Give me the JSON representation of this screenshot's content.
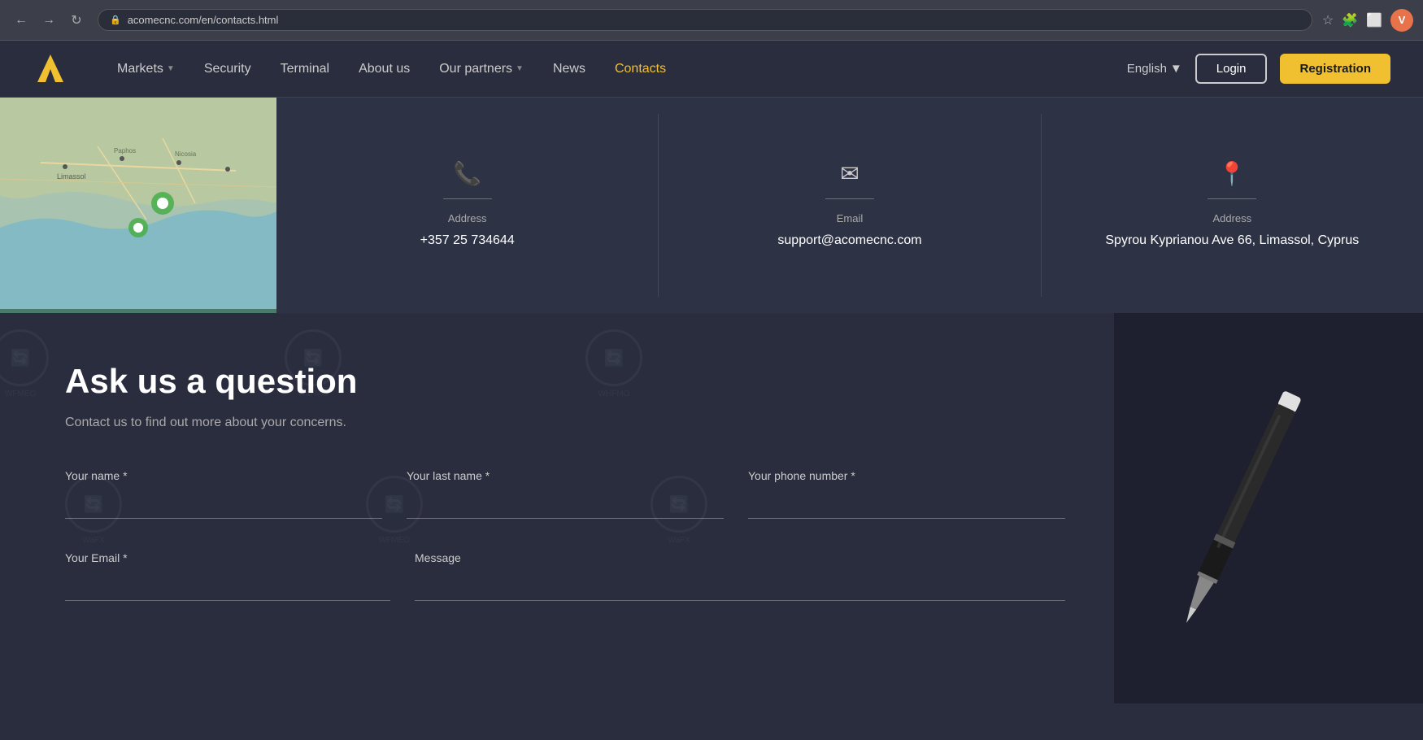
{
  "browser": {
    "url": "acomecnc.com/en/contacts.html",
    "user_initial": "V"
  },
  "navbar": {
    "logo_letter": "A",
    "links": [
      {
        "id": "markets",
        "label": "Markets",
        "has_dropdown": true,
        "active": false
      },
      {
        "id": "security",
        "label": "Security",
        "has_dropdown": false,
        "active": false
      },
      {
        "id": "terminal",
        "label": "Terminal",
        "has_dropdown": false,
        "active": false
      },
      {
        "id": "about-us",
        "label": "About us",
        "has_dropdown": false,
        "active": false
      },
      {
        "id": "our-partners",
        "label": "Our partners",
        "has_dropdown": true,
        "active": false
      },
      {
        "id": "news",
        "label": "News",
        "has_dropdown": false,
        "active": false
      },
      {
        "id": "contacts",
        "label": "Contacts",
        "has_dropdown": false,
        "active": true
      }
    ],
    "language": "English",
    "login_label": "Login",
    "register_label": "Registration"
  },
  "contact_panels": [
    {
      "id": "phone",
      "icon": "📞",
      "label": "Address",
      "value": "+357 25 734644"
    },
    {
      "id": "email",
      "icon": "✉",
      "label": "Email",
      "value": "support@acomecnc.com"
    },
    {
      "id": "location",
      "icon": "📍",
      "label": "Address",
      "value": "Spyrou Kyprianou Ave 66, Limassol, Cyprus"
    }
  ],
  "ask_form": {
    "title": "Ask us a question",
    "subtitle": "Contact us to find out more about your concerns.",
    "fields": [
      {
        "id": "name",
        "label": "Your name",
        "required": true,
        "placeholder": ""
      },
      {
        "id": "last-name",
        "label": "Your last name",
        "required": true,
        "placeholder": ""
      },
      {
        "id": "phone",
        "label": "Your phone number",
        "required": true,
        "placeholder": ""
      },
      {
        "id": "email",
        "label": "Your Email",
        "required": true,
        "placeholder": ""
      },
      {
        "id": "message",
        "label": "Message",
        "required": false,
        "placeholder": ""
      }
    ]
  },
  "watermarks": [
    {
      "label": "WFMEO"
    },
    {
      "label": "WaFMO"
    },
    {
      "label": "WHFMO"
    }
  ]
}
